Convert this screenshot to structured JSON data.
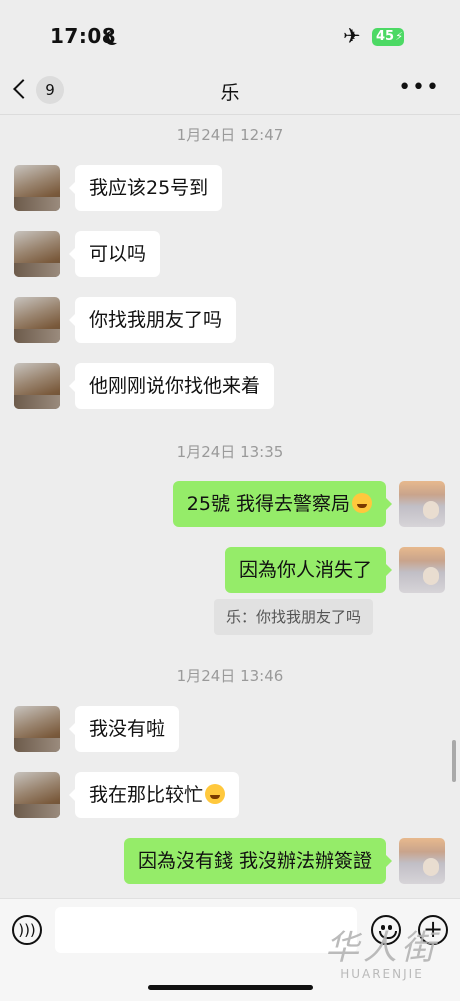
{
  "status_bar": {
    "time": "17:08",
    "battery": "45"
  },
  "nav": {
    "unread_count": "9",
    "title": "乐"
  },
  "chat": {
    "separators": [
      "1月24日 12:47",
      "1月24日 13:35",
      "1月24日 13:46"
    ],
    "messages": [
      {
        "side": "left",
        "text": "我应该25号到"
      },
      {
        "side": "left",
        "text": "可以吗"
      },
      {
        "side": "left",
        "text": "你找我朋友了吗"
      },
      {
        "side": "left",
        "text": "他刚刚说你找他来着"
      },
      {
        "side": "right",
        "text": "25號 我得去警察局",
        "emoji": "laughing-crying"
      },
      {
        "side": "right",
        "text": "因為你人消失了"
      },
      {
        "side": "left",
        "text": "我没有啦"
      },
      {
        "side": "left",
        "text": "我在那比较忙",
        "emoji": "laughing-crying"
      },
      {
        "side": "right",
        "text": "因為沒有錢 我沒辦法辦簽證"
      }
    ],
    "quote": "乐：你找我朋友了吗"
  },
  "input": {
    "value": ""
  },
  "watermark": {
    "cn": "华人街",
    "en": "HUARENJIE"
  },
  "colors": {
    "background": "#ededed",
    "outgoing_bubble": "#95ec69",
    "incoming_bubble": "#ffffff"
  }
}
